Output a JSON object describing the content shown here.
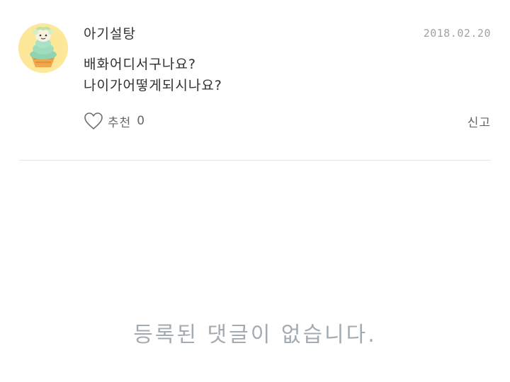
{
  "post": {
    "author": "아기설탕",
    "date": "2018.02.20",
    "lines": [
      "배화어디서구나요?",
      "나이가어떻게되시나요?"
    ],
    "recommend_label": "추천",
    "recommend_count": "0",
    "report_label": "신고"
  },
  "comments": {
    "empty_message": "등록된 댓글이 없습니다."
  },
  "icons": {
    "avatar": "ice-cream-character-avatar",
    "recommend": "heart-outline-icon"
  },
  "colors": {
    "avatar_bg": "#fde89a",
    "divider": "#dde6ec",
    "muted_text": "#a3abb2"
  }
}
